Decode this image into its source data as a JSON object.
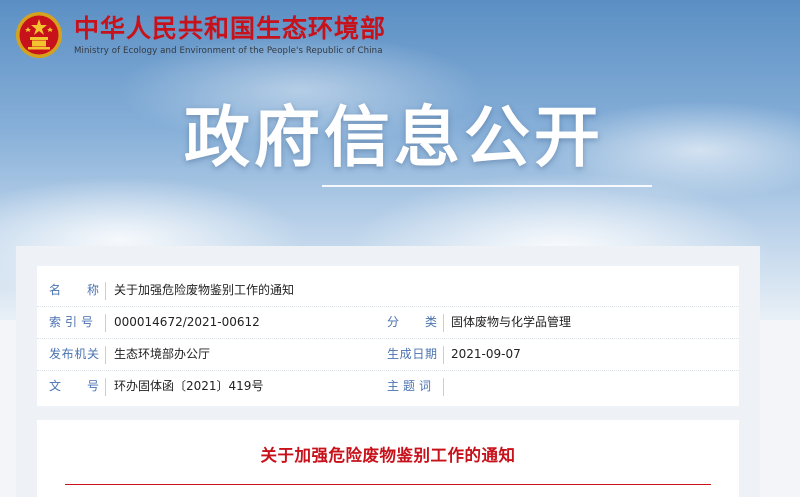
{
  "site": {
    "name_cn": "中华人民共和国生态环境部",
    "name_en": "Ministry of Ecology and Environment of the People's Republic of China",
    "emblem_icon": "national-emblem-icon",
    "brand_color": "#c8121b"
  },
  "banner": {
    "title": "政府信息公开"
  },
  "meta": {
    "name_label": "名　　称",
    "name_value": "关于加强危险废物鉴别工作的通知",
    "index_label": "索引号",
    "index_value": "000014672/2021-00612",
    "category_label": "分　　类",
    "category_value": "固体废物与化学品管理",
    "issuer_label": "发布机关",
    "issuer_value": "生态环境部办公厅",
    "date_label": "生成日期",
    "date_value": "2021-09-07",
    "docno_label": "文　　号",
    "docno_value": "环办固体函〔2021〕419号",
    "subject_label": "主题词",
    "subject_value": ""
  },
  "article": {
    "title": "关于加强危险废物鉴别工作的通知"
  }
}
